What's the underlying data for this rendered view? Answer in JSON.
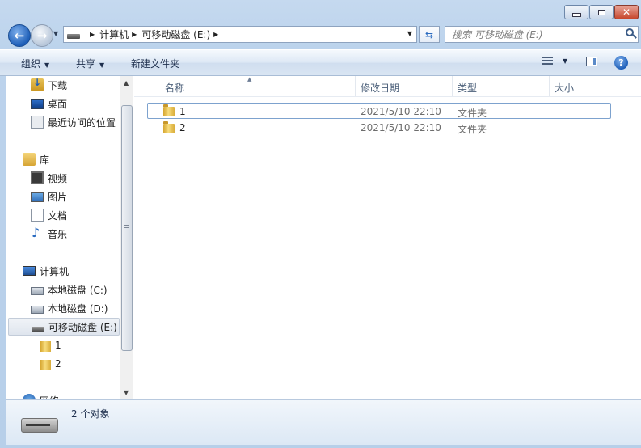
{
  "address": {
    "crumbs": [
      "计算机",
      "可移动磁盘 (E:)"
    ]
  },
  "search": {
    "placeholder": "搜索 可移动磁盘 (E:)"
  },
  "toolbar": {
    "organize": "组织",
    "share": "共享",
    "new_folder": "新建文件夹"
  },
  "nav": {
    "favorites": [
      {
        "label": "下载",
        "icon": "download-icon"
      },
      {
        "label": "桌面",
        "icon": "desktop-icon"
      },
      {
        "label": "最近访问的位置",
        "icon": "recent-places-icon"
      }
    ],
    "libraries": {
      "label": "库",
      "items": [
        {
          "label": "视频",
          "icon": "video-icon"
        },
        {
          "label": "图片",
          "icon": "pictures-icon"
        },
        {
          "label": "文档",
          "icon": "documents-icon"
        },
        {
          "label": "音乐",
          "icon": "music-icon"
        }
      ]
    },
    "computer": {
      "label": "计算机",
      "items": [
        {
          "label": "本地磁盘 (C:)",
          "icon": "local-disk-c-icon"
        },
        {
          "label": "本地磁盘 (D:)",
          "icon": "local-disk-d-icon"
        },
        {
          "label": "可移动磁盘 (E:)",
          "icon": "removable-disk-icon"
        }
      ],
      "subfolders": [
        "1",
        "2"
      ]
    },
    "network": {
      "label": "网络"
    }
  },
  "columns": {
    "name": "名称",
    "modified": "修改日期",
    "type": "类型",
    "size": "大小"
  },
  "files": [
    {
      "name": "1",
      "modified": "2021/5/10 22:10",
      "type": "文件夹"
    },
    {
      "name": "2",
      "modified": "2021/5/10 22:10",
      "type": "文件夹"
    }
  ],
  "status": {
    "count": "2 个对象"
  }
}
